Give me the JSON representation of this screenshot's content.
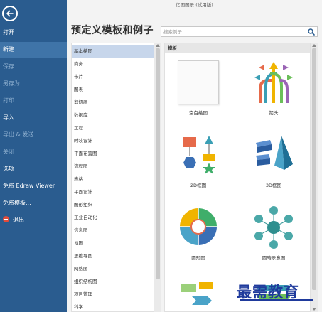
{
  "titlebar": {
    "title": "亿图图示 (试用版)"
  },
  "sidebar": {
    "items": [
      {
        "label": "打开",
        "state": "normal"
      },
      {
        "label": "新建",
        "state": "active"
      },
      {
        "label": "保存",
        "state": "disabled"
      },
      {
        "label": "另存为",
        "state": "disabled"
      },
      {
        "label": "打印",
        "state": "disabled"
      },
      {
        "label": "导入",
        "state": "normal"
      },
      {
        "label": "导出 & 发送",
        "state": "disabled"
      },
      {
        "label": "关闭",
        "state": "disabled"
      },
      {
        "label": "选项",
        "state": "normal"
      },
      {
        "label": "免费 Edraw Viewer",
        "state": "normal"
      },
      {
        "label": "免费模板...",
        "state": "normal"
      },
      {
        "label": "退出",
        "state": "normal",
        "icon": "exit-icon"
      }
    ]
  },
  "main": {
    "title": "预定义模板和例子",
    "search": {
      "placeholder": "搜索例子..."
    }
  },
  "categories": {
    "selected_index": 0,
    "items": [
      "基本绘图",
      "商务",
      "卡片",
      "图表",
      "剪切画",
      "数据库",
      "工程",
      "时装设计",
      "平面布置图",
      "流程图",
      "表格",
      "平面设计",
      "图形组织",
      "工业自动化",
      "信息图",
      "地图",
      "思维导图",
      "网络图",
      "组织结构图",
      "项目管理",
      "科学"
    ]
  },
  "templates": {
    "header": "模板",
    "items": [
      {
        "label": "空白绘图",
        "icon": "blank-page-icon"
      },
      {
        "label": "箭头",
        "icon": "arrows-icon"
      },
      {
        "label": "2D框图",
        "icon": "2d-block-icon"
      },
      {
        "label": "3D框图",
        "icon": "3d-block-icon"
      },
      {
        "label": "圆形图",
        "icon": "circular-diagram-icon"
      },
      {
        "label": "圆暗示意图",
        "icon": "circle-spoke-icon"
      }
    ]
  },
  "watermark": {
    "text": "最需教育"
  },
  "colors": {
    "sidebar": "#2a5c8f",
    "sidebar_active": "#3f74a8",
    "category_selected": "#c7d6eb",
    "watermark": "#1f3a9c"
  }
}
